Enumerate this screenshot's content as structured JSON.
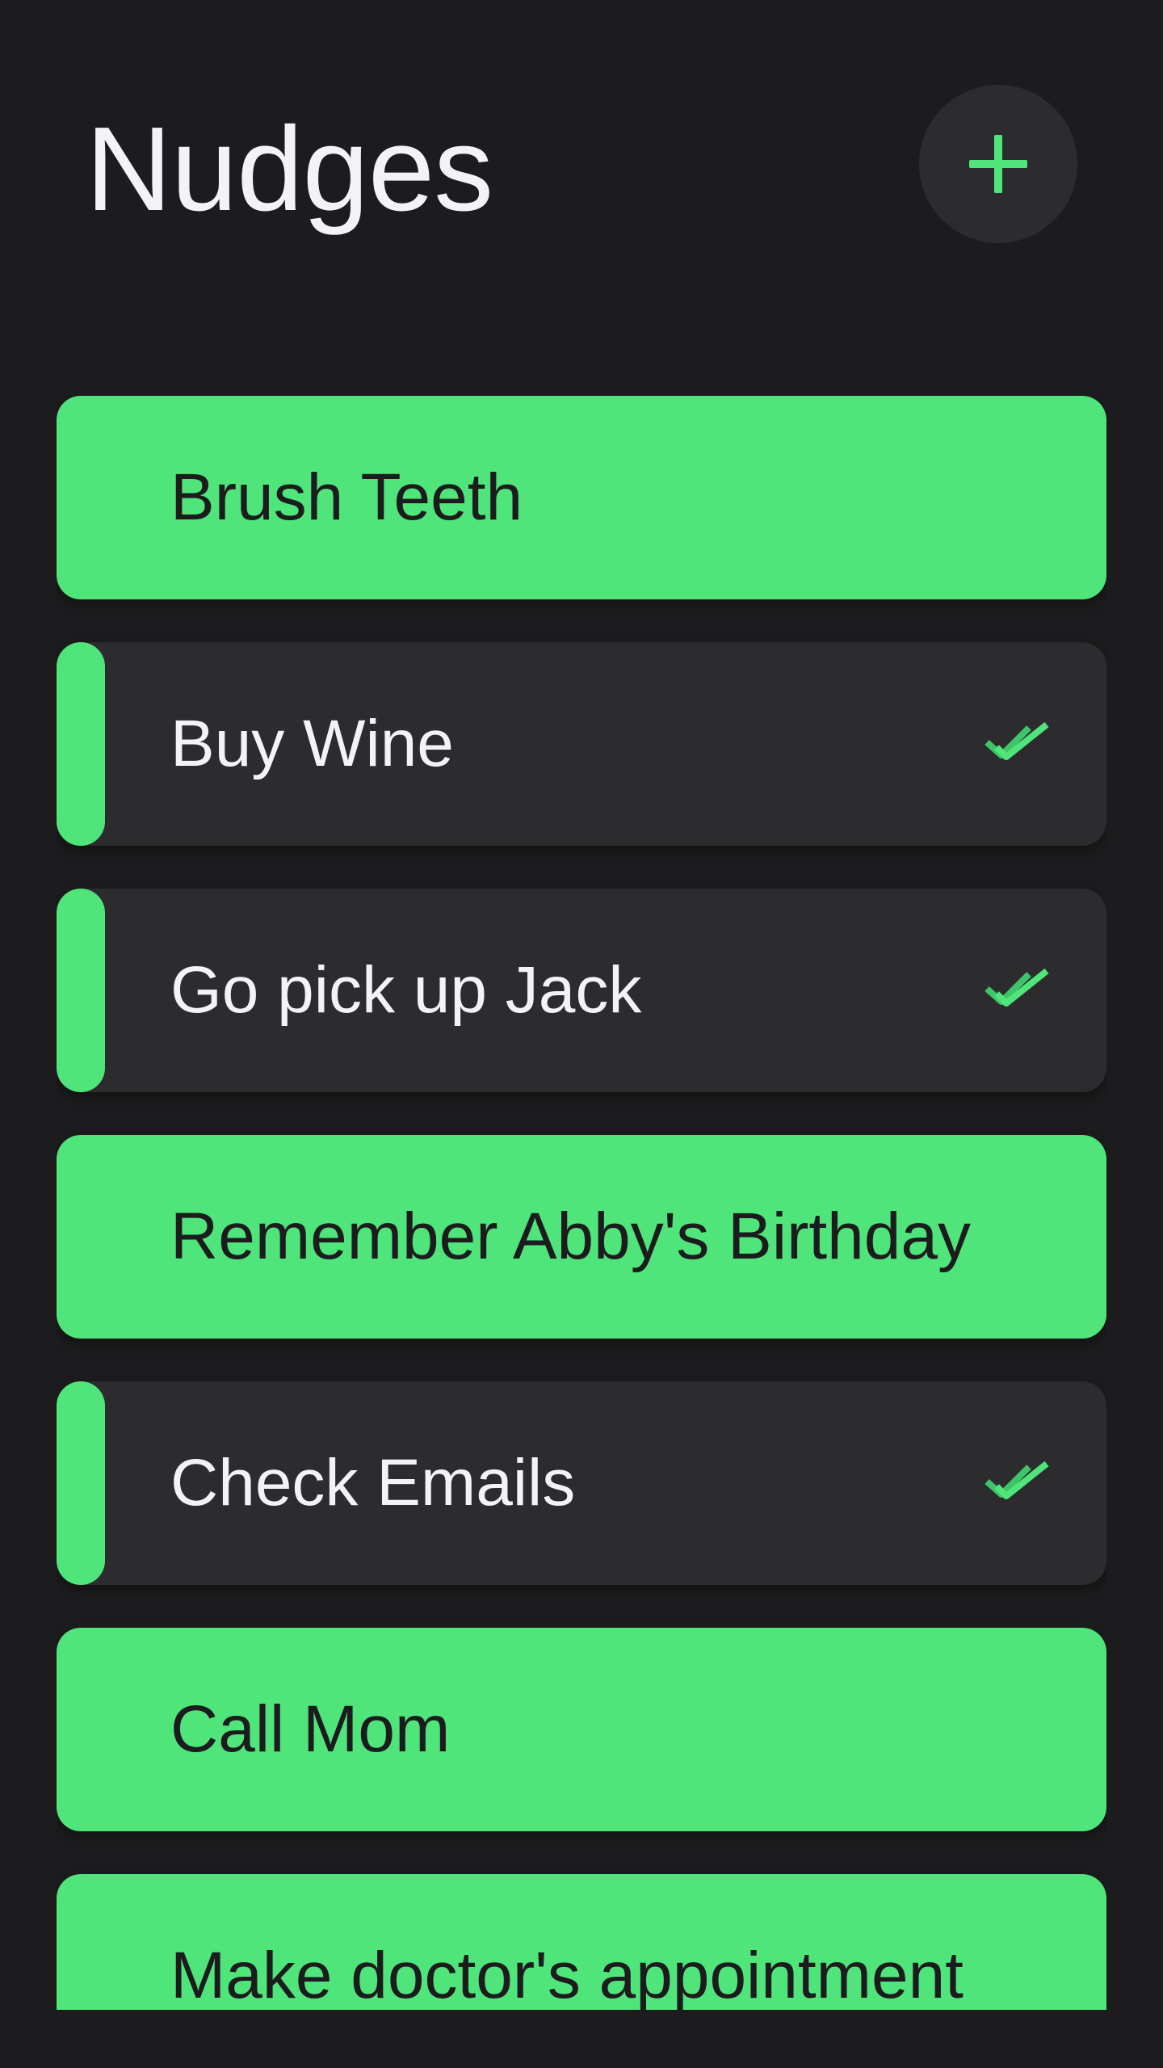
{
  "header": {
    "title": "Nudges",
    "add_icon": "plus-icon"
  },
  "colors": {
    "background": "#1c1c1e",
    "card_dark": "#2c2c2e",
    "accent_green": "#50e57b",
    "text_light": "#f2f2f7",
    "text_dark": "#1c1c1e"
  },
  "nudges": [
    {
      "label": "Brush Teeth",
      "completed": false
    },
    {
      "label": "Buy Wine",
      "completed": true,
      "icon": "double-check-icon"
    },
    {
      "label": "Go pick up Jack",
      "completed": true,
      "icon": "double-check-icon"
    },
    {
      "label": "Remember Abby's Birthday",
      "completed": false
    },
    {
      "label": "Check Emails",
      "completed": true,
      "icon": "double-check-icon"
    },
    {
      "label": "Call Mom",
      "completed": false
    },
    {
      "label": "Make doctor's appointment",
      "completed": false
    }
  ]
}
